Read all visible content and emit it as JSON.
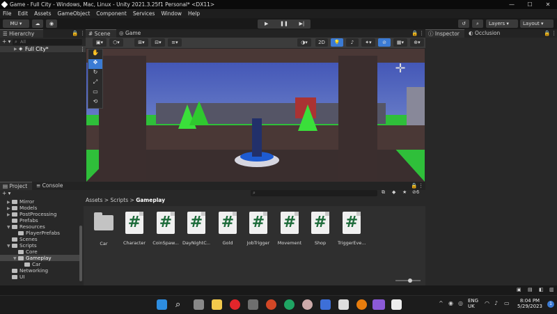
{
  "window": {
    "title": "Game - Full City - Windows, Mac, Linux - Unity 2021.3.25f1 Personal* <DX11>",
    "minimize": "—",
    "maximize": "☐",
    "close": "✕"
  },
  "menu": [
    "File",
    "Edit",
    "Assets",
    "GameObject",
    "Component",
    "Services",
    "Window",
    "Help"
  ],
  "toolbar": {
    "account": "MU ▾",
    "layers": "Layers",
    "layout": "Layout"
  },
  "play": {
    "play": "▶",
    "pause": "❚❚",
    "step": "▶|"
  },
  "hierarchy": {
    "tab": "Hierarchy",
    "add": "+ ▾",
    "search_placeholder": "All",
    "root": "Full City*"
  },
  "scene": {
    "tab_scene": "Scene",
    "tab_game": "Game",
    "mode_2d": "2D"
  },
  "inspector": {
    "tab": "Inspector",
    "tab_occlusion": "Occlusion"
  },
  "project": {
    "tab": "Project",
    "tab_console": "Console",
    "add": "+ ▾",
    "breadcrumb": [
      "Assets",
      "Scripts",
      "Gameplay"
    ],
    "hidden_count": "6",
    "tree": [
      {
        "label": "Mirror",
        "depth": 1,
        "arrow": "▶"
      },
      {
        "label": "Models",
        "depth": 1,
        "arrow": "▶"
      },
      {
        "label": "PostProcessing",
        "depth": 1,
        "arrow": "▶"
      },
      {
        "label": "Prefabs",
        "depth": 1,
        "arrow": ""
      },
      {
        "label": "Resources",
        "depth": 1,
        "arrow": "▼"
      },
      {
        "label": "PlayerPrefabs",
        "depth": 2,
        "arrow": ""
      },
      {
        "label": "Scenes",
        "depth": 1,
        "arrow": ""
      },
      {
        "label": "Scripts",
        "depth": 1,
        "arrow": "▼"
      },
      {
        "label": "Core",
        "depth": 2,
        "arrow": ""
      },
      {
        "label": "Gameplay",
        "depth": 2,
        "arrow": "▼"
      },
      {
        "label": "Car",
        "depth": 3,
        "arrow": ""
      },
      {
        "label": "Networking",
        "depth": 2,
        "arrow": ""
      },
      {
        "label": "UI",
        "depth": 2,
        "arrow": ""
      }
    ],
    "assets": [
      {
        "name": "Car",
        "type": "folder"
      },
      {
        "name": "Character",
        "type": "script"
      },
      {
        "name": "CoinSpaw...",
        "type": "script"
      },
      {
        "name": "DayNightC...",
        "type": "script"
      },
      {
        "name": "Gold",
        "type": "script"
      },
      {
        "name": "JobTrigger",
        "type": "script"
      },
      {
        "name": "Movement",
        "type": "script"
      },
      {
        "name": "Shop",
        "type": "script"
      },
      {
        "name": "TriggerEve...",
        "type": "script"
      }
    ],
    "script_glyph": "#"
  },
  "taskbar": {
    "lang": "ENG",
    "region": "UK",
    "time": "8:04 PM",
    "date": "5/29/2023",
    "notif": "1"
  },
  "colors": {
    "accent": "#3b7bd4",
    "script": "#1d6b3a",
    "sky": "#4d62ba",
    "grass": "#2fbf3a"
  }
}
